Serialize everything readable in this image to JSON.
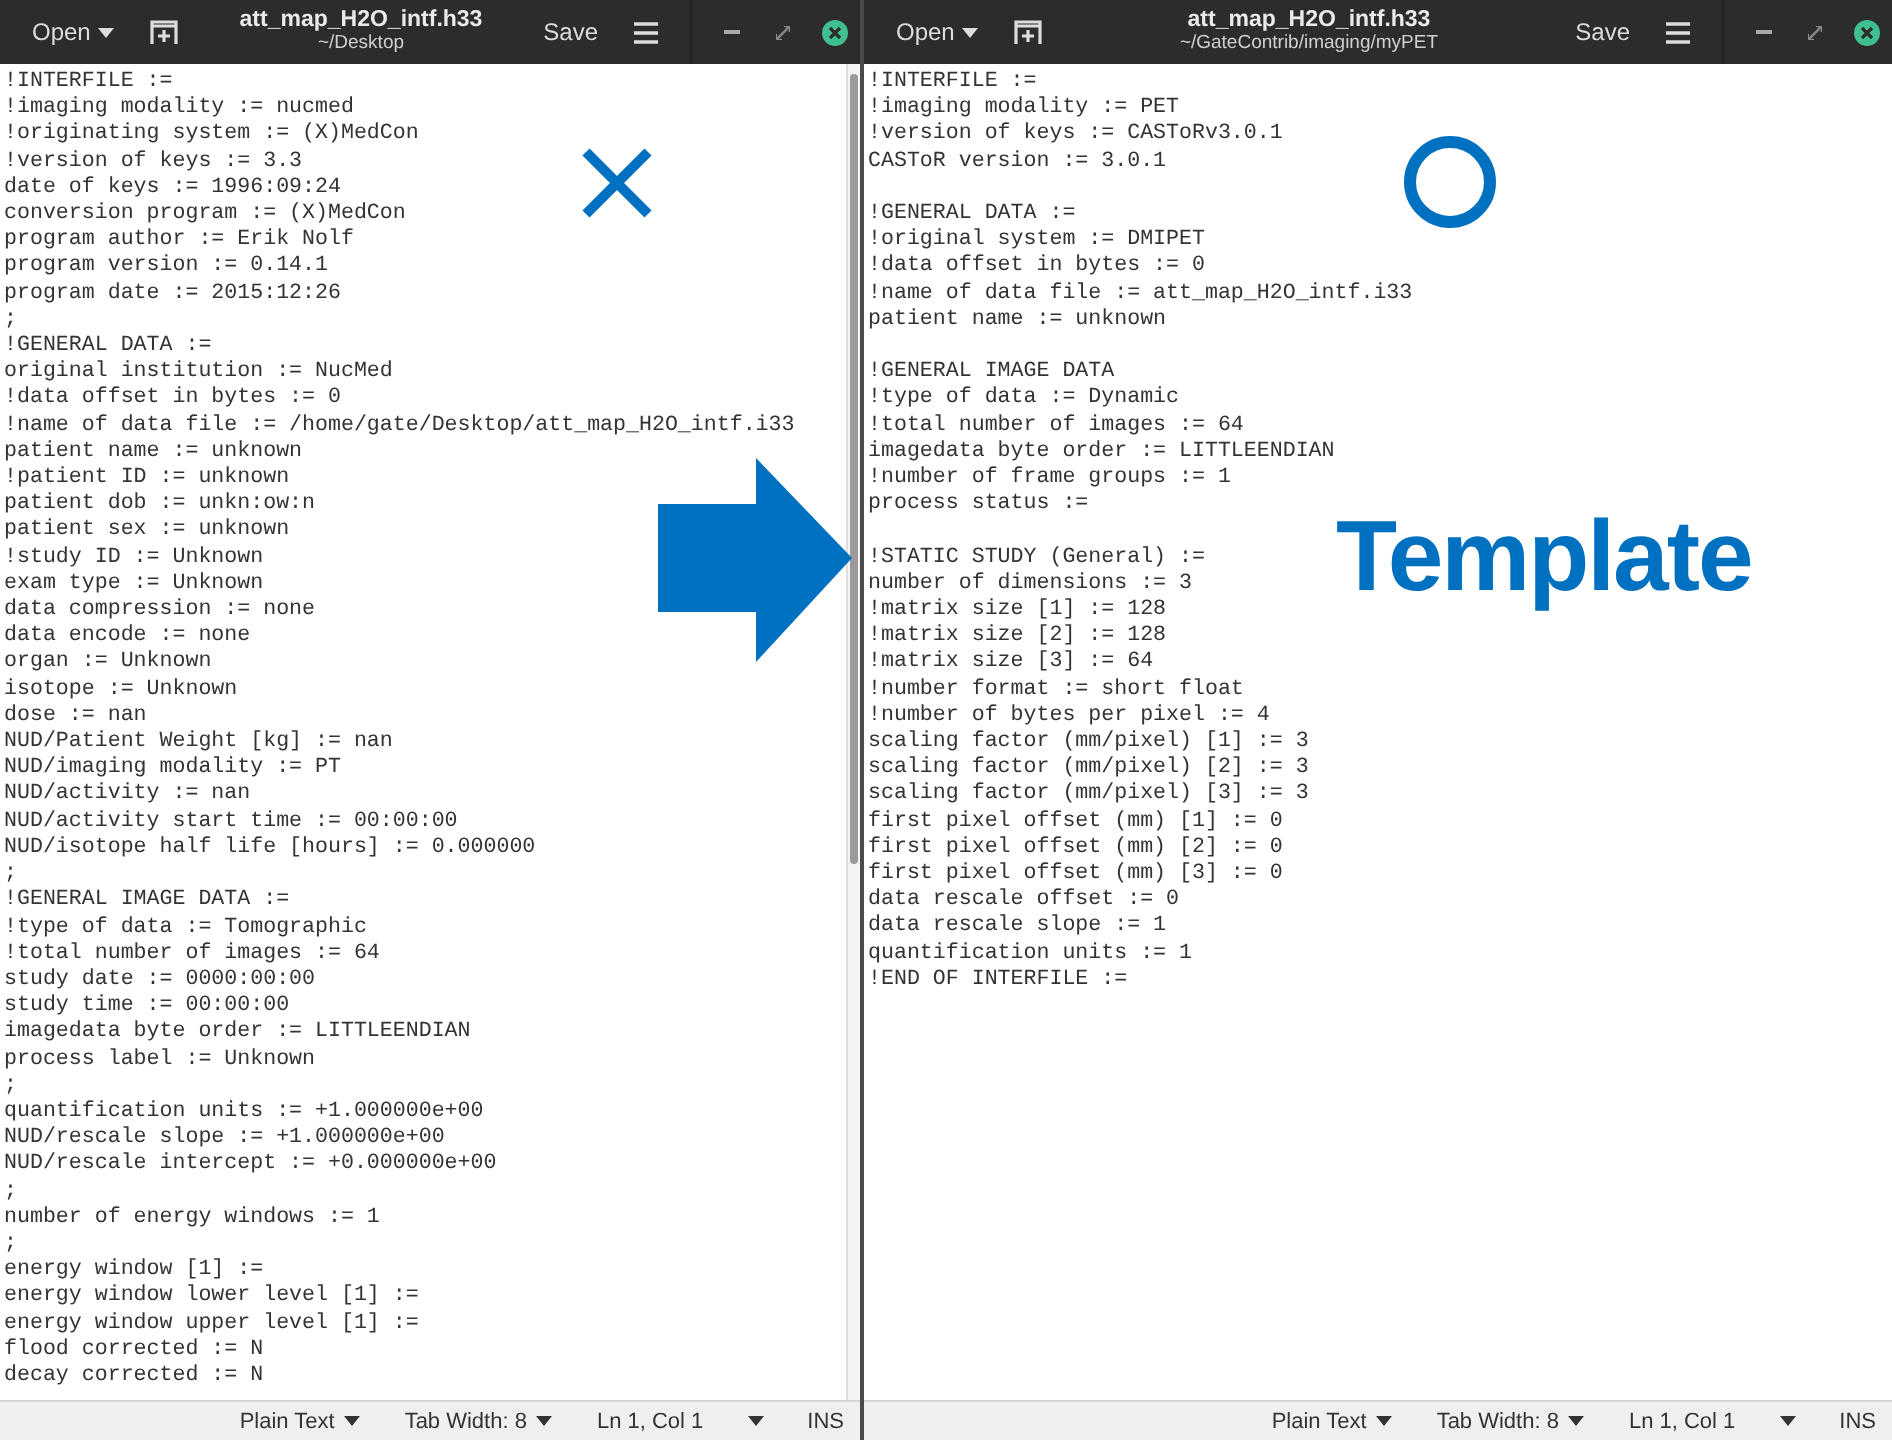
{
  "windows": [
    {
      "title": "att_map_H2O_intf.h33",
      "path": "~/Desktop",
      "open_label": "Open",
      "save_label": "Save",
      "scrollbar": true,
      "blocks": [
        [
          "!INTERFILE :=",
          "!imaging modality := nucmed",
          "!originating system := (X)MedCon",
          "!version of keys := 3.3",
          "date of keys := 1996:09:24",
          "conversion program := (X)MedCon",
          "program author := Erik Nolf",
          "program version := 0.14.1",
          "program date := 2015:12:26",
          ";",
          "!GENERAL DATA :=",
          "original institution := NucMed",
          "!data offset in bytes := 0",
          "!name of data file := /home/gate/Desktop/att_map_H2O_intf.i33",
          "patient name := unknown",
          "!patient ID := unknown",
          "patient dob := unkn:ow:n",
          "patient sex := unknown",
          "!study ID := Unknown",
          "exam type := Unknown",
          "data compression := none",
          "data encode := none",
          "organ := Unknown",
          "isotope := Unknown",
          "dose := nan",
          "NUD/Patient Weight [kg] := nan",
          "NUD/imaging modality := PT",
          "NUD/activity := nan",
          "NUD/activity start time := 00:00:00",
          "NUD/isotope half life [hours] := 0.000000",
          ";",
          "!GENERAL IMAGE DATA :=",
          "!type of data := Tomographic",
          "!total number of images := 64",
          "study date := 0000:00:00",
          "study time := 00:00:00",
          "imagedata byte order := LITTLEENDIAN",
          "process label := Unknown",
          ";",
          "quantification units := +1.000000e+00",
          "NUD/rescale slope := +1.000000e+00",
          "NUD/rescale intercept := +0.000000e+00",
          ";",
          "number of energy windows := 1",
          ";",
          "energy window [1] :=",
          "energy window lower level [1] :=",
          "energy window upper level [1] :=",
          "flood corrected := N",
          "decay corrected := N"
        ]
      ],
      "status": {
        "language": "Plain Text",
        "tab_width": "Tab Width: 8",
        "position": "Ln 1, Col 1",
        "mode": "INS"
      }
    },
    {
      "title": "att_map_H2O_intf.h33",
      "path": "~/GateContrib/imaging/myPET",
      "open_label": "Open",
      "save_label": "Save",
      "scrollbar": false,
      "blocks": [
        [
          "!INTERFILE :=",
          "!imaging modality := PET",
          "!version of keys := CASToRv3.0.1",
          "CASToR version := 3.0.1"
        ],
        [
          "!GENERAL DATA :=",
          "!original system := DMIPET",
          "!data offset in bytes := 0",
          "!name of data file := att_map_H2O_intf.i33",
          "patient name := unknown"
        ],
        [
          "!GENERAL IMAGE DATA",
          "!type of data := Dynamic",
          "!total number of images := 64",
          "imagedata byte order := LITTLEENDIAN",
          "!number of frame groups := 1",
          "process status :="
        ],
        [
          "!STATIC STUDY (General) :=",
          "number of dimensions := 3",
          "!matrix size [1] := 128",
          "!matrix size [2] := 128",
          "!matrix size [3] := 64",
          "!number format := short float",
          "!number of bytes per pixel := 4",
          "scaling factor (mm/pixel) [1] := 3",
          "scaling factor (mm/pixel) [2] := 3",
          "scaling factor (mm/pixel) [3] := 3",
          "first pixel offset (mm) [1] := 0",
          "first pixel offset (mm) [2] := 0",
          "first pixel offset (mm) [3] := 0",
          "data rescale offset := 0",
          "data rescale slope := 1",
          "quantification units := 1",
          "!END OF INTERFILE :="
        ]
      ],
      "status": {
        "language": "Plain Text",
        "tab_width": "Tab Width: 8",
        "position": "Ln 1, Col 1",
        "mode": "INS"
      }
    }
  ],
  "annotations": [
    {
      "kind": "cross"
    },
    {
      "kind": "arrow"
    },
    {
      "kind": "circle"
    },
    {
      "kind": "label",
      "text": "Template"
    }
  ]
}
